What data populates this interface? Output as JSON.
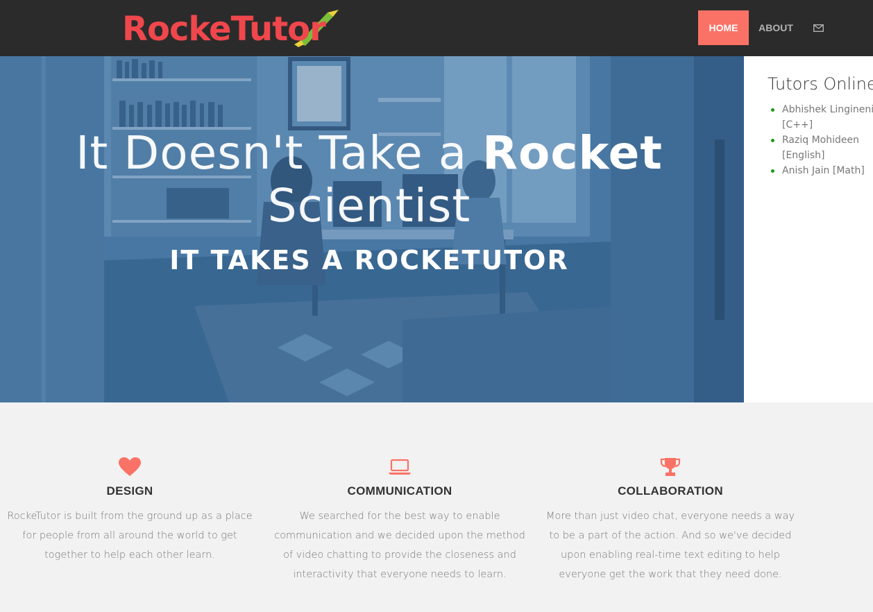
{
  "brand": {
    "logo_text": "RockeTutor"
  },
  "nav": {
    "home_label": "HOME",
    "about_label": "ABOUT",
    "mail_icon": "envelope-icon",
    "accent_color": "#fa7266"
  },
  "hero": {
    "title_light": "It Doesn't Take a",
    "title_bold": "Rocket",
    "title_line2": "Scientist",
    "subtitle": "IT TAKES A ROCKETUTOR"
  },
  "tutors": {
    "title": "Tutors Online",
    "items": [
      {
        "label": "Abhishek Lingineni [C++]"
      },
      {
        "label": "Raziq Mohideen [English]"
      },
      {
        "label": "Anish Jain [Math]"
      }
    ],
    "status_color": "#1a9a1a"
  },
  "features": [
    {
      "icon": "heart-icon",
      "title": "DESIGN",
      "text": "RockeTutor is built from the ground up as a place for people from all around the world to get together to help each other learn."
    },
    {
      "icon": "laptop-icon",
      "title": "COMMUNICATION",
      "text": "We searched for the best way to enable communication and we decided upon the method of video chatting to provide the closeness and interactivity that everyone needs to learn."
    },
    {
      "icon": "trophy-icon",
      "title": "COLLABORATION",
      "text": "More than just video chat, everyone needs a way to be a part of the action. And so we've decided upon enabling real-time text editing to help everyone get the work that they need done."
    }
  ]
}
